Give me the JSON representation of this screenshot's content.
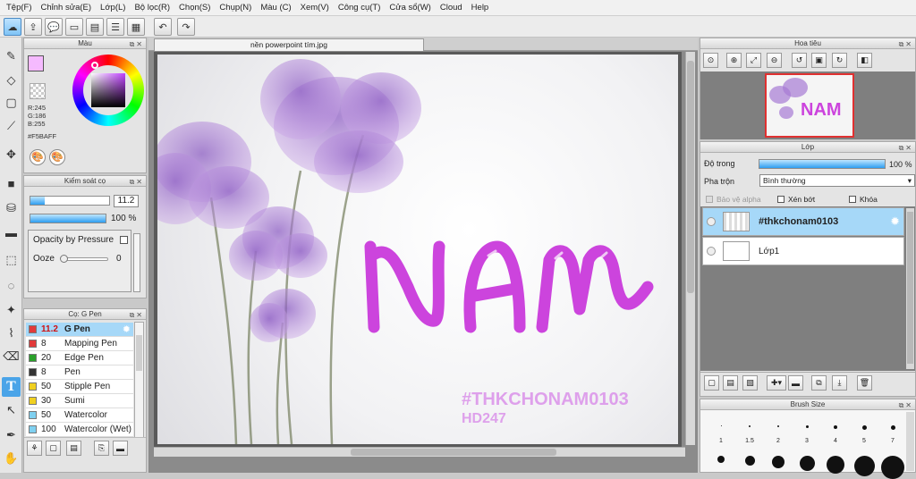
{
  "menu": [
    "Tệp(F)",
    "Chỉnh sửa(E)",
    "Lớp(L)",
    "Bộ lọc(R)",
    "Chọn(S)",
    "Chụp(N)",
    "Màu (C)",
    "Xem(V)",
    "Công cụ(T)",
    "Cửa sổ(W)",
    "Cloud",
    "Help"
  ],
  "document": {
    "tab_title": "nền powerpoint tím.jpg"
  },
  "color_panel": {
    "title": "Màu",
    "primary_color": "#F5BAFF",
    "r_label": "R:245",
    "g_label": "G:186",
    "b_label": "B:255",
    "hex_label": "#F5BAFF"
  },
  "brush_control": {
    "title": "Kiểm soát cọ",
    "size_value": "11.2",
    "size_fraction": 0.18,
    "opacity_value": "100 %",
    "opacity_fraction": 1.0,
    "opacity_by_pressure_label": "Opacity by Pressure",
    "ooze_label": "Ooze",
    "ooze_value": "0"
  },
  "brush_list": {
    "title": "Cọ: G Pen",
    "items": [
      {
        "size": "11.2",
        "name": "G Pen",
        "color": "#e23b3b",
        "selected": true
      },
      {
        "size": "8",
        "name": "Mapping Pen",
        "color": "#e23b3b",
        "selected": false
      },
      {
        "size": "20",
        "name": "Edge Pen",
        "color": "#2aa02a",
        "selected": false
      },
      {
        "size": "8",
        "name": "Pen",
        "color": "#333333",
        "selected": false
      },
      {
        "size": "50",
        "name": "Stipple Pen",
        "color": "#f0d020",
        "selected": false
      },
      {
        "size": "30",
        "name": "Sumi",
        "color": "#f0d020",
        "selected": false
      },
      {
        "size": "50",
        "name": "Watercolor",
        "color": "#7fd0f0",
        "selected": false
      },
      {
        "size": "100",
        "name": "Watercolor (Wet)",
        "color": "#7fd0f0",
        "selected": false
      }
    ]
  },
  "navigator": {
    "title": "Hoa tiêu"
  },
  "layer_panel": {
    "title": "Lớp",
    "opacity_label": "Độ trong",
    "opacity_value": "100 %",
    "opacity_fraction": 1.0,
    "blend_label": "Pha trộn",
    "blend_value": "Bình thường",
    "protect_alpha_label": "Bảo vệ alpha",
    "clipping_label": "Xén bớt",
    "lock_label": "Khóa",
    "layers": [
      {
        "name": "#thkchonam0103",
        "selected": true
      },
      {
        "name": "Lớp1",
        "selected": false
      }
    ]
  },
  "brush_size": {
    "title": "Brush Size",
    "sizes": [
      "1",
      "1.5",
      "2",
      "3",
      "4",
      "5",
      "7"
    ]
  },
  "artwork": {
    "main_text": "NAM",
    "hashtag": "#THKCHONAM0103",
    "sub": "HD247",
    "accent_color": "#cc44dd",
    "petal_color": "#b07fd6"
  }
}
